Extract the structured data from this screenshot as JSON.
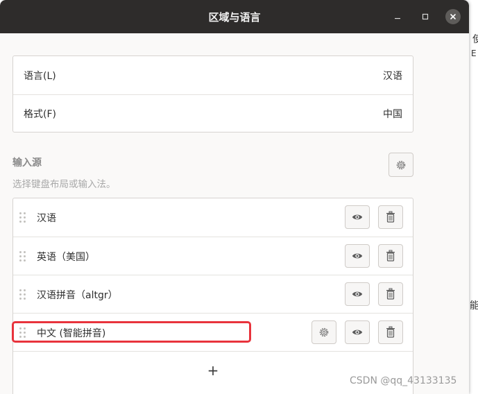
{
  "window": {
    "title": "区域与语言",
    "controls": {
      "minimize": "–",
      "maximize": "□",
      "close": "×"
    }
  },
  "background": {
    "fragment_top": "使",
    "fragment_mid": "能",
    "fragment_small": "E"
  },
  "settings": {
    "language": {
      "label": "语言(L)",
      "value": "汉语"
    },
    "format": {
      "label": "格式(F)",
      "value": "中国"
    }
  },
  "input_sources": {
    "title": "输入源",
    "subtitle": "选择键盘布局或输入法。",
    "items": [
      {
        "label": "汉语",
        "has_settings": false
      },
      {
        "label": "英语（美国）",
        "has_settings": false
      },
      {
        "label": "汉语拼音（altgr）",
        "has_settings": false
      },
      {
        "label": "中文 (智能拼音)",
        "has_settings": true
      }
    ],
    "add_label": "+"
  },
  "watermark": "CSDN @qq_43133135",
  "colors": {
    "titlebar": "#2e2c2b",
    "highlight": "#e8333c",
    "accent": "#e95420"
  },
  "icons": {
    "settings": "gear-icon",
    "preview": "eye-icon",
    "remove": "trash-icon",
    "drag": "drag-handle-icon"
  }
}
